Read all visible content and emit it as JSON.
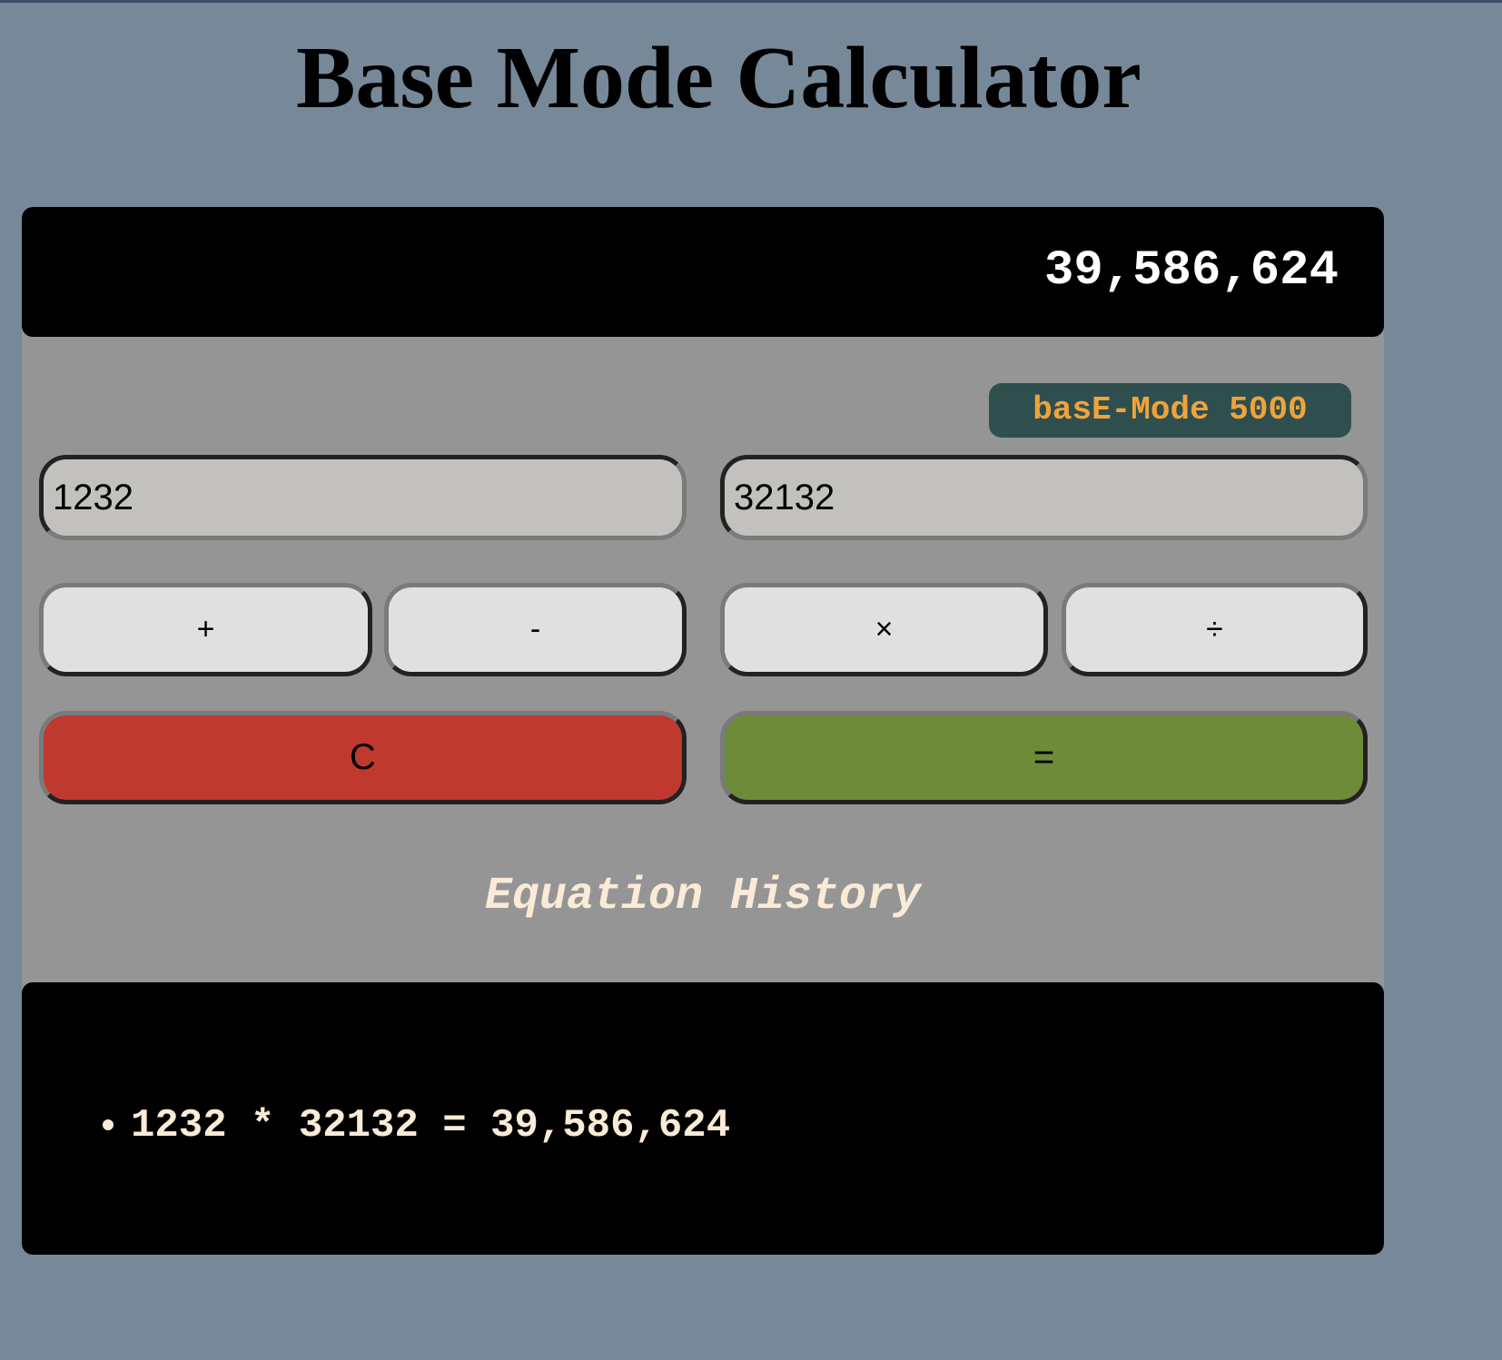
{
  "page": {
    "title": "Base Mode Calculator"
  },
  "display": {
    "value": "39,586,624"
  },
  "mode_badge": {
    "label": "basE-Mode 5000"
  },
  "inputs": {
    "operand_a": "1232",
    "operand_b": "32132"
  },
  "operators": {
    "add": "+",
    "subtract": "-",
    "multiply": "×",
    "divide": "÷"
  },
  "actions": {
    "clear": "C",
    "equals": "="
  },
  "history": {
    "heading": "Equation History",
    "items": [
      "1232 * 32132 = 39,586,624"
    ]
  },
  "colors": {
    "background": "#778899",
    "panel": "#959595",
    "display": "#000000",
    "badge_bg": "#2f4f4f",
    "badge_text": "#f0a33a",
    "clear": "#c0392f",
    "equals": "#6e8b39",
    "history_text": "#faebd7"
  }
}
